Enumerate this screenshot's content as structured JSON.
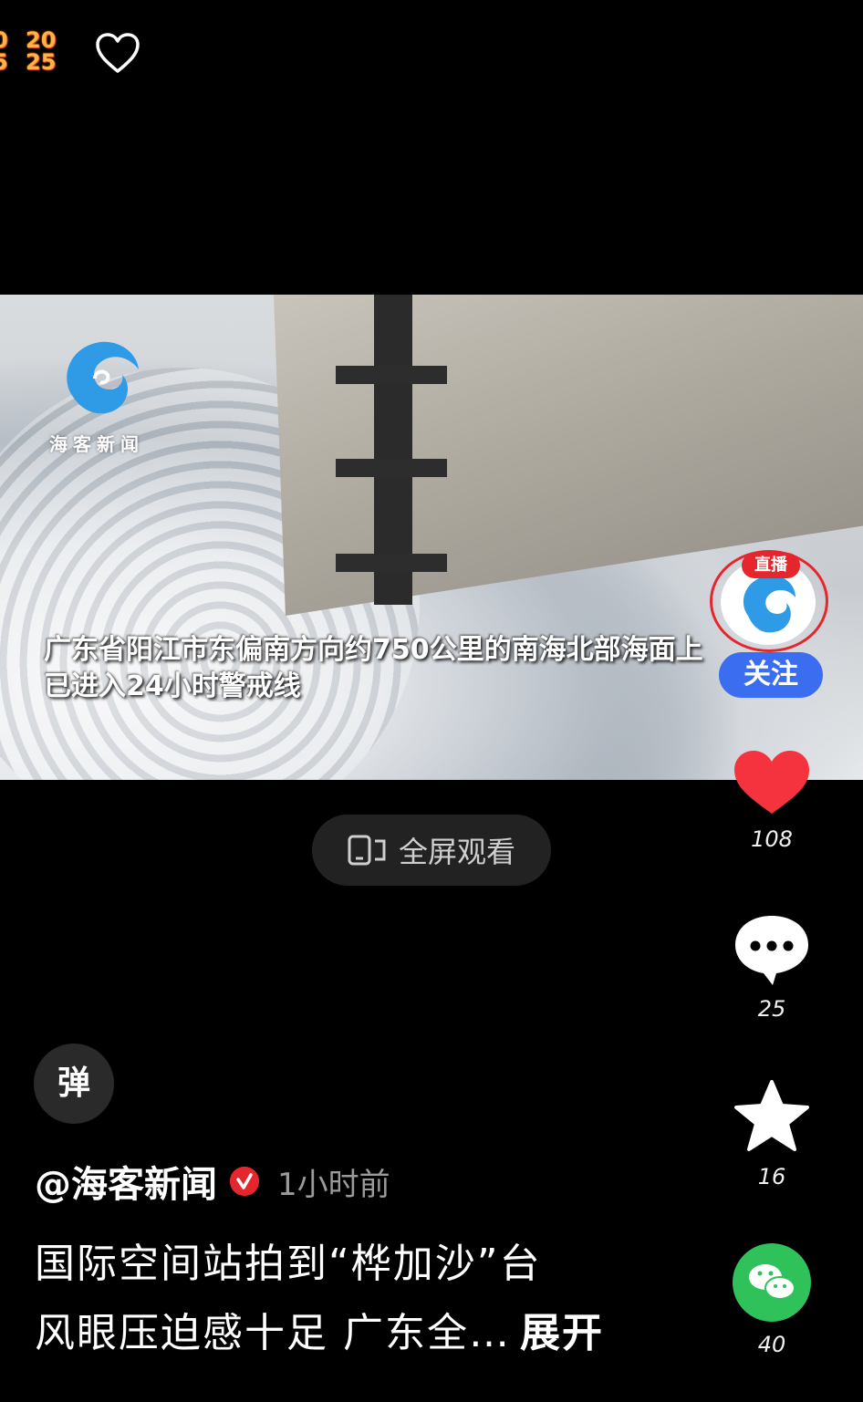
{
  "top": {
    "badge_line1": "20",
    "badge_line2": "25",
    "badge_partial1": "0",
    "badge_partial2": "5"
  },
  "video": {
    "watermark": "海客新闻",
    "subtitle_line1": "广东省阳江市东偏南方向约750公里的南海北部海面上",
    "subtitle_line2": "已进入24小时警戒线"
  },
  "fullscreen": {
    "label": "全屏观看"
  },
  "sidebar": {
    "live_label": "直播",
    "follow_label": "关注",
    "likes": "108",
    "comments": "25",
    "favorites": "16",
    "shares": "40"
  },
  "bottom": {
    "danmu_label": "弹",
    "author": "@海客新闻",
    "time_ago": "1小时前",
    "caption_line1": "国际空间站拍到“桦加沙”台",
    "caption_line2": "风眼压迫感十足 广东全…",
    "expand_label": "展开"
  },
  "colors": {
    "accent_red": "#e5262c",
    "follow_blue": "#3a6df0",
    "share_green": "#2fc15a",
    "like_red": "#f5333f"
  }
}
